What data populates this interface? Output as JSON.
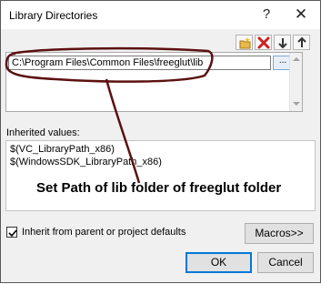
{
  "window": {
    "title": "Library Directories",
    "help_label": "?",
    "close_label": "✕"
  },
  "toolbar": {
    "buttons": [
      {
        "name": "new-line-button",
        "icon": "folder-new-icon"
      },
      {
        "name": "delete-line-button",
        "icon": "delete-icon"
      },
      {
        "name": "move-down-button",
        "icon": "arrow-down-icon"
      },
      {
        "name": "move-up-button",
        "icon": "arrow-up-icon"
      }
    ]
  },
  "directories": {
    "entries": [
      "C:\\Program Files\\Common Files\\freeglut\\lib"
    ],
    "browse_label": "..."
  },
  "inherited": {
    "label": "Inherited values:",
    "values": [
      "$(VC_LibraryPath_x86)",
      "$(WindowsSDK_LibraryPath_x86)"
    ]
  },
  "annotation": {
    "text": "Set Path of lib folder of freeglut folder",
    "color": "#5c1010"
  },
  "inherit_checkbox": {
    "label": "Inherit from parent or project defaults",
    "checked": true
  },
  "buttons": {
    "macros": "Macros>>",
    "ok": "OK",
    "cancel": "Cancel"
  },
  "colors": {
    "delete_icon": "#cc2222",
    "folder_icon": "#e8b84a",
    "focus_blue": "#0078d7"
  }
}
